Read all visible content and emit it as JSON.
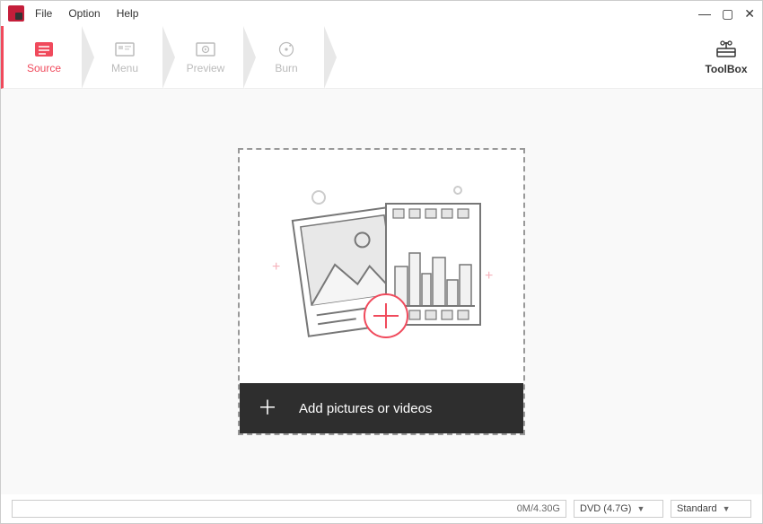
{
  "menu": {
    "file": "File",
    "option": "Option",
    "help": "Help"
  },
  "steps": {
    "source": "Source",
    "menu": "Menu",
    "preview": "Preview",
    "burn": "Burn"
  },
  "toolbox": {
    "label": "ToolBox"
  },
  "dropzone": {
    "label": "Add pictures or videos"
  },
  "status": {
    "progress": "0M/4.30G",
    "disc": "DVD (4.7G)",
    "quality": "Standard"
  }
}
